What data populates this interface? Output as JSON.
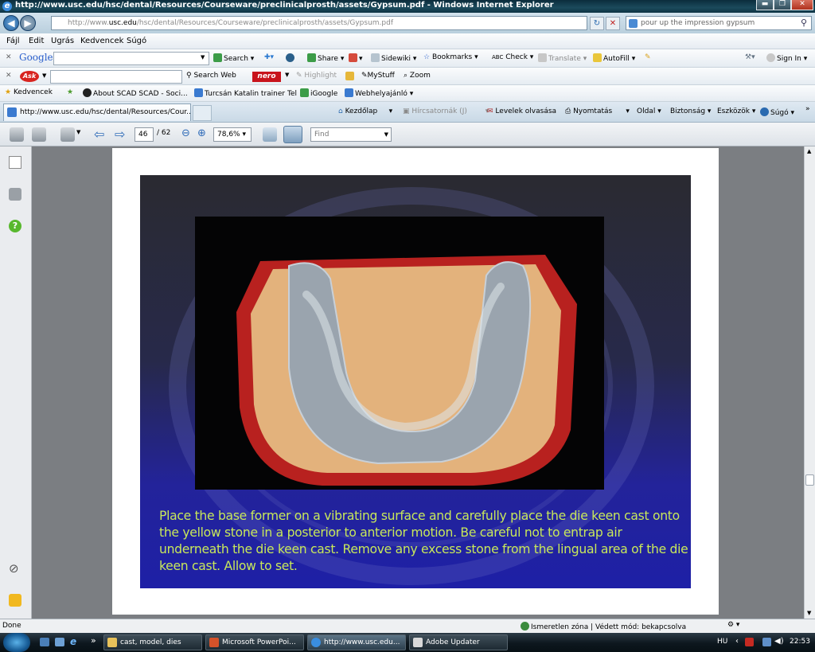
{
  "window": {
    "title": "http://www.usc.edu/hsc/dental/Resources/Courseware/preclinicalprosth/assets/Gypsum.pdf - Windows Internet Explorer",
    "min": "▬",
    "max": "❐",
    "close": "✕"
  },
  "address": {
    "url_prefix": "http://www.",
    "url_domain": "usc.edu",
    "url_rest": "/hsc/dental/Resources/Courseware/preclinicalprosth/assets/Gypsum.pdf",
    "search_value": "pour up the impression  gypsum"
  },
  "menu": [
    "Fájl",
    "Edit",
    "Ugrás",
    "Kedvencek",
    "Súgó"
  ],
  "google_toolbar": {
    "logo": "Google",
    "search": "Search",
    "share": "Share",
    "sidewiki": "Sidewiki",
    "bookmarks": "Bookmarks",
    "check": "Check",
    "translate": "Translate",
    "autofill": "AutoFill",
    "sign_in": "Sign In"
  },
  "ask_toolbar": {
    "logo": "Ask",
    "search_web": "Search Web",
    "nero": "nero",
    "highlight": "Highlight",
    "mystuff": "MyStuff",
    "zoom": "Zoom"
  },
  "favorites_bar": {
    "label": "Kedvencek",
    "items": [
      "About SCAD  SCAD - Soci...",
      "Turcsán Katalin trainer Tel",
      "iGoogle",
      "Webhelyajánló"
    ]
  },
  "tabs": {
    "active_label": "http://www.usc.edu/hsc/dental/Resources/Cour..."
  },
  "command_bar": {
    "home": "Kezdőlap",
    "feeds": "Hírcsatornák (J)",
    "mail": "Levelek olvasása",
    "print": "Nyomtatás",
    "page": "Oldal",
    "safety": "Biztonság",
    "tools": "Eszközök",
    "help": "Súgó"
  },
  "pdf_toolbar": {
    "current_page": "46",
    "total_pages": "/ 62",
    "zoom": "78,6%",
    "find_placeholder": "Find"
  },
  "slide": {
    "caption": "Place the base former on a vibrating surface and carefully place the die keen cast onto the yellow stone in a posterior to anterior motion. Be careful not to entrap air underneath the die keen cast. Remove any excess stone from the lingual area of the die keen cast. Allow to set."
  },
  "status": {
    "left": "Done",
    "zone": "Ismeretlen zóna | Védett mód: bekapcsolva"
  },
  "taskbar": {
    "items": [
      "cast, model, dies",
      "Microsoft PowerPoi...",
      "http://www.usc.edu...",
      "Adobe Updater"
    ],
    "lang": "HU",
    "time": "22:53"
  },
  "colors": {
    "caption": "#c8e85a",
    "slide_bottom": "#1e20a6",
    "stone_yellow": "#e3b27c",
    "base_red": "#b8211f",
    "cast_grey": "#9aa4ae"
  }
}
